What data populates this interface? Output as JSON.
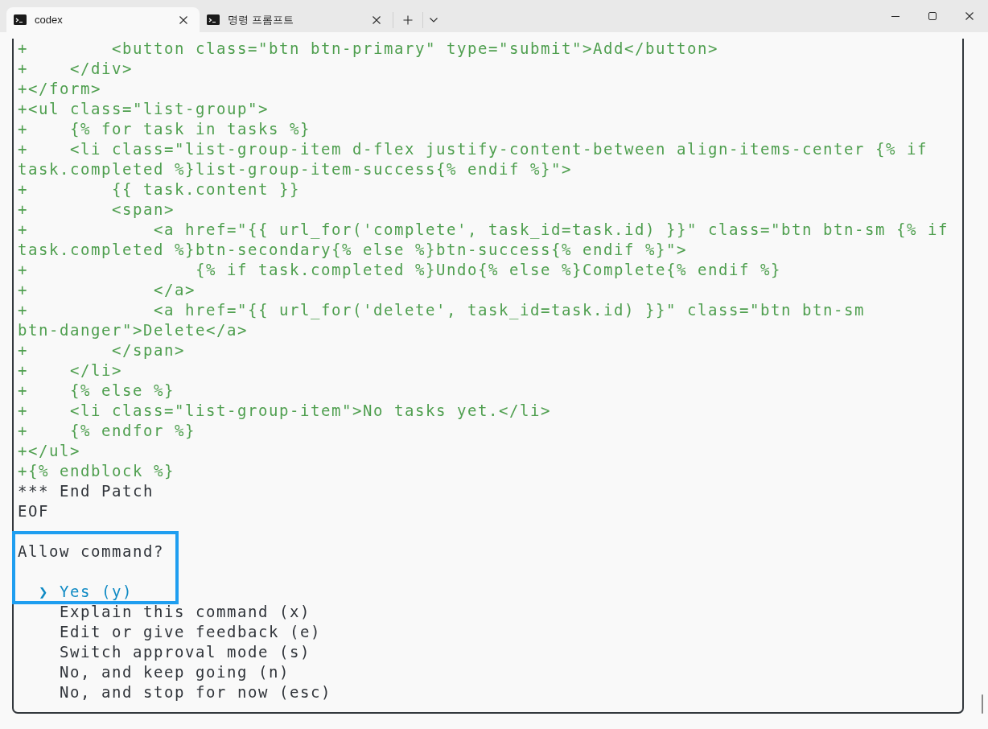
{
  "tabs": [
    {
      "title": "codex",
      "selected": true
    },
    {
      "title": "명령 프롬프트",
      "selected": false
    }
  ],
  "terminal": {
    "lines": [
      {
        "kind": "added",
        "text": "+        <button class=\"btn btn-primary\" type=\"submit\">Add</button>"
      },
      {
        "kind": "added",
        "text": "+    </div>"
      },
      {
        "kind": "added",
        "text": "+</form>"
      },
      {
        "kind": "added",
        "text": "+<ul class=\"list-group\">"
      },
      {
        "kind": "added",
        "text": "+    {% for task in tasks %}"
      },
      {
        "kind": "added",
        "text": "+    <li class=\"list-group-item d-flex justify-content-between align-items-center {% if"
      },
      {
        "kind": "added",
        "text": "task.completed %}list-group-item-success{% endif %}\">"
      },
      {
        "kind": "added",
        "text": "+        {{ task.content }}"
      },
      {
        "kind": "added",
        "text": "+        <span>"
      },
      {
        "kind": "added",
        "text": "+            <a href=\"{{ url_for('complete', task_id=task.id) }}\" class=\"btn btn-sm {% if"
      },
      {
        "kind": "added",
        "text": "task.completed %}btn-secondary{% else %}btn-success{% endif %}\">"
      },
      {
        "kind": "added",
        "text": "+                {% if task.completed %}Undo{% else %}Complete{% endif %}"
      },
      {
        "kind": "added",
        "text": "+            </a>"
      },
      {
        "kind": "added",
        "text": "+            <a href=\"{{ url_for('delete', task_id=task.id) }}\" class=\"btn btn-sm"
      },
      {
        "kind": "added",
        "text": "btn-danger\">Delete</a>"
      },
      {
        "kind": "added",
        "text": "+        </span>"
      },
      {
        "kind": "added",
        "text": "+    </li>"
      },
      {
        "kind": "added",
        "text": "+    {% else %}"
      },
      {
        "kind": "added",
        "text": "+    <li class=\"list-group-item\">No tasks yet.</li>"
      },
      {
        "kind": "added",
        "text": "+    {% endfor %}"
      },
      {
        "kind": "added",
        "text": "+</ul>"
      },
      {
        "kind": "added",
        "text": "+{% endblock %}"
      },
      {
        "kind": "plain",
        "text": "*** End Patch"
      },
      {
        "kind": "plain",
        "text": "EOF"
      }
    ],
    "prompt": {
      "question": "Allow command?",
      "pointer": "❯",
      "options": [
        {
          "label": "Yes (y)",
          "selected": true
        },
        {
          "label": "Explain this command (x)",
          "selected": false
        },
        {
          "label": "Edit or give feedback (e)",
          "selected": false
        },
        {
          "label": "Switch approval mode (s)",
          "selected": false
        },
        {
          "label": "No, and keep going (n)",
          "selected": false
        },
        {
          "label": "No, and stop for now (esc)",
          "selected": false
        }
      ]
    }
  }
}
